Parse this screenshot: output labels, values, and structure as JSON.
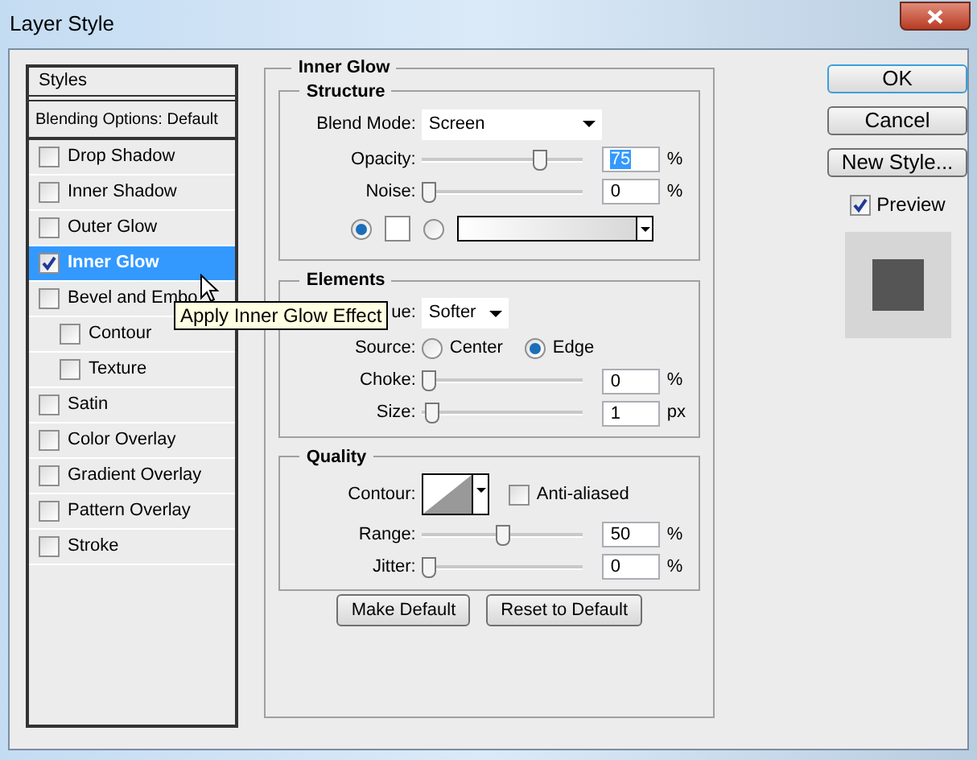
{
  "window": {
    "title": "Layer Style"
  },
  "styles_panel": {
    "header": "Styles",
    "blending": "Blending Options: Default",
    "items": [
      {
        "label": "Drop Shadow",
        "checked": false,
        "selected": false
      },
      {
        "label": "Inner Shadow",
        "checked": false,
        "selected": false
      },
      {
        "label": "Outer Glow",
        "checked": false,
        "selected": false
      },
      {
        "label": "Inner Glow",
        "checked": true,
        "selected": true
      },
      {
        "label": "Bevel and Embo",
        "checked": false,
        "selected": false,
        "children": [
          {
            "label": "Contour",
            "checked": false,
            "selected": false
          },
          {
            "label": "Texture",
            "checked": false,
            "selected": false
          }
        ]
      },
      {
        "label": "Satin",
        "checked": false,
        "selected": false
      },
      {
        "label": "Color Overlay",
        "checked": false,
        "selected": false
      },
      {
        "label": "Gradient Overlay",
        "checked": false,
        "selected": false
      },
      {
        "label": "Pattern Overlay",
        "checked": false,
        "selected": false
      },
      {
        "label": "Stroke",
        "checked": false,
        "selected": false
      }
    ]
  },
  "tooltip": "Apply Inner Glow Effect",
  "inner_glow": {
    "title": "Inner Glow",
    "structure": {
      "title": "Structure",
      "blend_mode": {
        "label": "Blend Mode:",
        "value": "Screen"
      },
      "sliders": [
        {
          "label": "Opacity:",
          "level": 0.75,
          "value": "75",
          "unit": "%",
          "text_selected": true
        },
        {
          "label": "Noise:",
          "level": 0,
          "value": "0",
          "unit": "%",
          "text_selected": false
        }
      ],
      "fill_options": [
        {
          "kind": "color",
          "selected": true
        },
        {
          "kind": "gradient",
          "selected": false
        }
      ]
    },
    "elements": {
      "title": "Elements",
      "technique": {
        "label": "ue:",
        "value": "Softer"
      },
      "source": {
        "label": "Source:",
        "options": [
          {
            "label": "Center",
            "selected": false
          },
          {
            "label": "Edge",
            "selected": true
          }
        ]
      },
      "sliders": [
        {
          "label": "Choke:",
          "level": 0,
          "value": "0",
          "unit": "%",
          "text_selected": false
        },
        {
          "label": "Size:",
          "level": 0.02,
          "value": "1",
          "unit": "px",
          "text_selected": false
        }
      ]
    },
    "quality": {
      "title": "Quality",
      "contour": {
        "label": "Contour:"
      },
      "anti_aliased": {
        "label": "Anti-aliased",
        "checked": false
      },
      "sliders": [
        {
          "label": "Range:",
          "level": 0.5,
          "value": "50",
          "unit": "%",
          "text_selected": false
        },
        {
          "label": "Jitter:",
          "level": 0,
          "value": "0",
          "unit": "%",
          "text_selected": false
        }
      ]
    },
    "buttons": [
      "Make Default",
      "Reset to Default"
    ]
  },
  "actions": [
    {
      "label": "OK",
      "default": true
    },
    {
      "label": "Cancel",
      "default": false
    },
    {
      "label": "New Style...",
      "default": false
    }
  ],
  "preview": {
    "label": "Preview",
    "checked": true
  }
}
